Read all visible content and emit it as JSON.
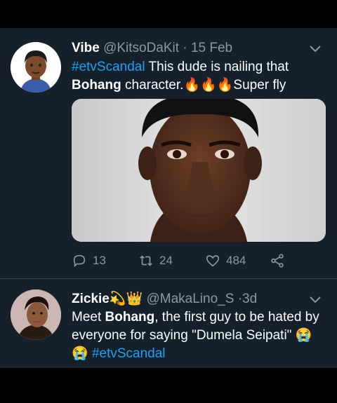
{
  "tweets": [
    {
      "name": "Vibe",
      "handle": "@KitsoDaKit",
      "sep": "·",
      "date": "15 Feb",
      "text": {
        "hashtag": "#etvScandal",
        "part1": " This dude is nailing that ",
        "bold": "Bohang",
        "part2": " character.",
        "emojis": "🔥🔥🔥",
        "part3": "Super fly"
      },
      "actions": {
        "replies": "13",
        "retweets": "24",
        "likes": "484"
      }
    },
    {
      "name": "Zickie",
      "name_emojis": "💫👑",
      "handle": "@MakaLino_S",
      "sep": "·",
      "date": "3d",
      "text": {
        "part1": "Meet ",
        "bold": "Bohang",
        "part2": ", the first guy to be hated by everyone for saying \"Dumela Seipati\" ",
        "emoji1": "😭",
        "emoji2": "😭",
        "hashtag": "#etvScandal"
      }
    }
  ],
  "icons": [
    "reply-icon",
    "retweet-icon",
    "like-icon",
    "share-icon",
    "chevron-down-icon",
    "compose-icon"
  ],
  "colors": {
    "background": "#15202b",
    "accent": "#1da1f2",
    "muted": "#8899a6",
    "divider": "#38444d"
  }
}
